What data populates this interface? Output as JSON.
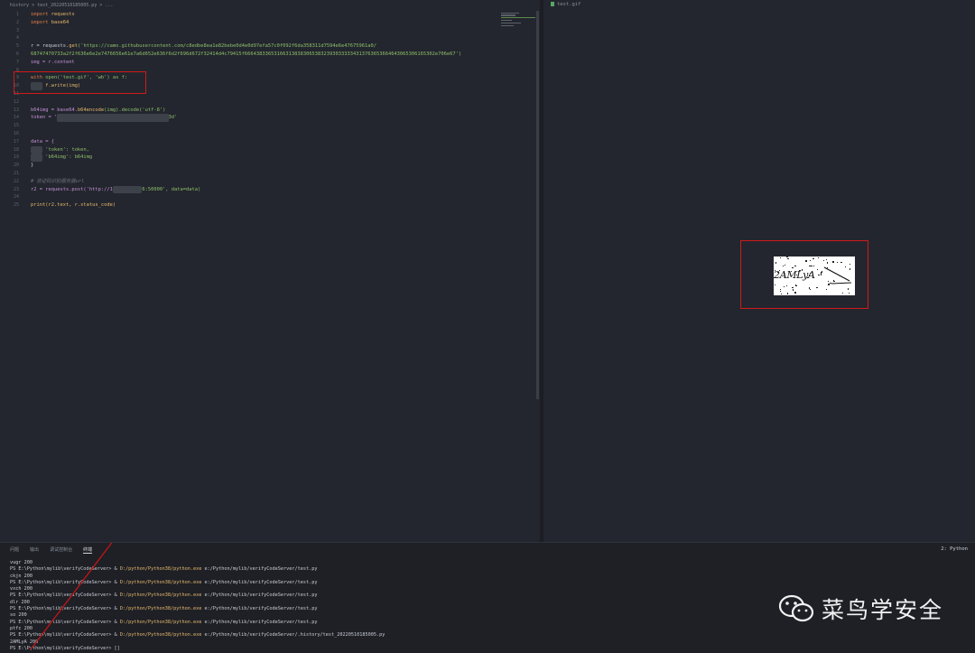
{
  "breadcrumb": "history > test_20220510185005.py > ...",
  "right_tab": "test.gif",
  "gutter": [
    "1",
    "2",
    "3",
    "4",
    "5",
    "6",
    "7",
    "8",
    "9",
    "10",
    "11",
    "12",
    "13",
    "14",
    "15",
    "16",
    "17",
    "18",
    "19",
    "20",
    "21",
    "22",
    "23",
    "24",
    "25"
  ],
  "code": {
    "l1_kw": "import",
    "l1_mod": " requests",
    "l2_kw": "import",
    "l2_mod": " base64",
    "l5_a": "r = requests.",
    "l5_fn": "get",
    "l5_str": "('https://camo.githubusercontent.com/c8edbe8ea1e82bebe0d4e0d97efa57c0f092f6da358311d7594e6e47675961a0/",
    "l5b_str": "68747470733a2f2f636e6e2e7476656e61e7a6d652e636f6d2f696d672f32414d4c79415f66643833653166313838306538323930333334313763653664643065306165302e706e67')",
    "l6": "img = r.content",
    "l8_kw": "with",
    "l8_rest": " open('test.gif', 'wb') as f:",
    "l9": "f.write(img)",
    "l12_a": "b64img = base64.",
    "l12_fn": "b64encode",
    "l12_b": "(img).decode('utf-8')",
    "l13_a": "token = '",
    "l13_b": "3d'",
    "l16": "data = {",
    "l17": "'token': token,",
    "l18": "'b64img': b64img",
    "l19": "}",
    "l21": "# 验证码识别服务器url",
    "l22_a": "r2 = requests.post('http://1",
    "l22_b": "6:50000', data=data)",
    "l24": "print(r2.text, r.status_code)"
  },
  "captcha_text": "2AMLyA",
  "panel": {
    "tabs": [
      "问题",
      "输出",
      "调试控制台",
      "终端"
    ],
    "shell": "2: Python"
  },
  "terminal": [
    {
      "t": "vugr 200"
    },
    {
      "p": "PS E:\\Python\\mylib\\verifyCodeServer> & ",
      "c": "D:/python/Python38/python.exe",
      "r": " e:/Python/mylib/verifyCodeServer/test.py"
    },
    {
      "t": "ckjn 200"
    },
    {
      "p": "PS E:\\Python\\mylib\\verifyCodeServer> & ",
      "c": "D:/python/Python38/python.exe",
      "r": " e:/Python/mylib/verifyCodeServer/test.py"
    },
    {
      "t": "vxch 200"
    },
    {
      "p": "PS E:\\Python\\mylib\\verifyCodeServer> & ",
      "c": "D:/python/Python38/python.exe",
      "r": " e:/Python/mylib/verifyCodeServer/test.py"
    },
    {
      "t": "dlr 200"
    },
    {
      "p": "PS E:\\Python\\mylib\\verifyCodeServer> & ",
      "c": "D:/python/Python38/python.exe",
      "r": " e:/Python/mylib/verifyCodeServer/test.py"
    },
    {
      "t": "so 200"
    },
    {
      "p": "PS E:\\Python\\mylib\\verifyCodeServer> & ",
      "c": "D:/python/Python38/python.exe",
      "r": " e:/Python/mylib/verifyCodeServer/test.py"
    },
    {
      "t": "ptfc 200"
    },
    {
      "p": "PS E:\\Python\\mylib\\verifyCodeServer> & ",
      "c": "D:/python/Python38/python.exe",
      "r": " e:/Python/mylib/verifyCodeServer/.history/test_20220510185005.py"
    },
    {
      "t": "2AMLyA 200"
    },
    {
      "t": "PS E:\\Python\\mylib\\verifyCodeServer> []"
    }
  ],
  "watermark": "菜鸟学安全",
  "colors": {
    "annotation": "#d11a1a",
    "editor_bg": "#23262e"
  }
}
